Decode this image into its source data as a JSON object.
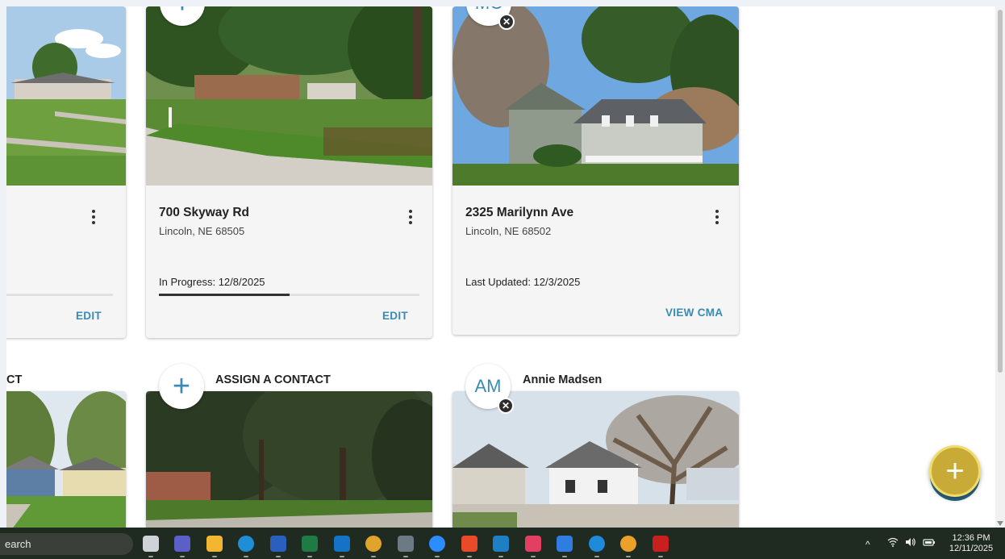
{
  "cards": [
    {
      "title": "",
      "subtitle": "",
      "status": "",
      "action": "EDIT",
      "progress": 1.0
    },
    {
      "title": "700 Skyway Rd",
      "subtitle": "Lincoln, NE 68505",
      "status": "In Progress: 12/8/2025",
      "action": "EDIT",
      "progress": 0.5
    },
    {
      "title": "2325 Marilynn Ave",
      "subtitle": "Lincoln, NE 68502",
      "status": "Last Updated: 12/3/2025",
      "action": "VIEW CMA"
    }
  ],
  "row2": {
    "card1": {
      "contact_label": "CT"
    },
    "card2": {
      "avatar": "+",
      "contact_label": "ASSIGN A CONTACT"
    },
    "card3": {
      "avatar": "AM",
      "contact_label": "Annie Madsen"
    }
  },
  "top_avatars": {
    "card2": "+",
    "card3": "MC"
  },
  "badge_glyph": "✕",
  "fab": {
    "label": "+"
  },
  "taskbar": {
    "search_text": "earch",
    "clock_time": "12:36 PM",
    "clock_date": "12/11/2025",
    "tray_chevron": "^"
  },
  "colors": {
    "accent": "#3b8ab3",
    "fab": "#c8ab37",
    "taskbar": "#1f2a20"
  }
}
